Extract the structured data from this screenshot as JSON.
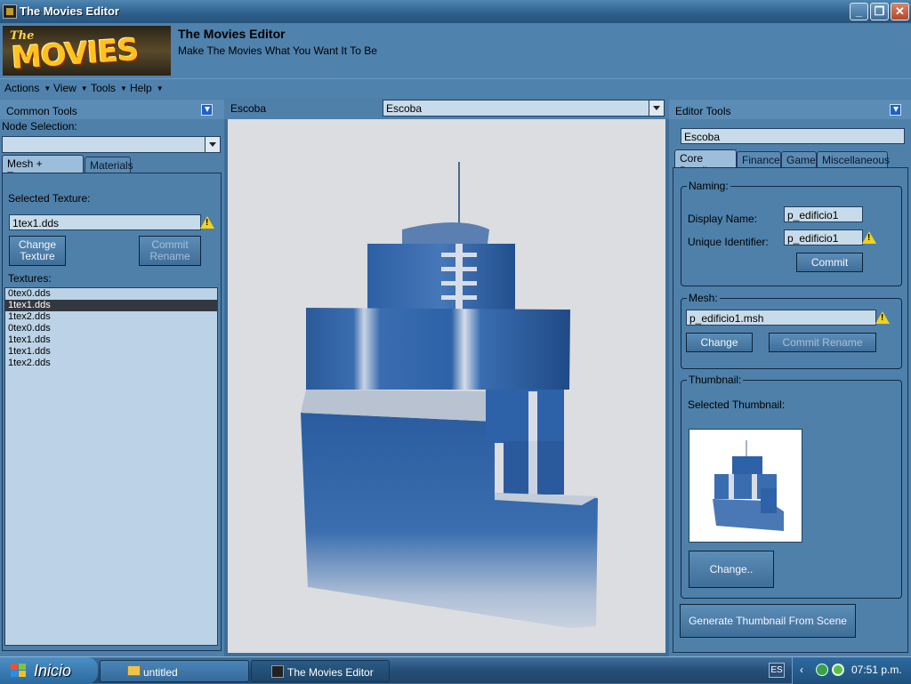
{
  "window": {
    "title": "The Movies Editor"
  },
  "header": {
    "logo_text_small": "The",
    "logo_text_big": "MOVIES",
    "title": "The Movies Editor",
    "subtitle": "Make The Movies What You Want It To Be"
  },
  "menu": [
    {
      "label": "Actions"
    },
    {
      "label": "View"
    },
    {
      "label": "Tools"
    },
    {
      "label": "Help"
    }
  ],
  "common_tools": {
    "header": "Common Tools",
    "node_selection_label": "Node Selection:",
    "node_selection_value": "",
    "tabs": [
      {
        "label": "Mesh + Textures"
      },
      {
        "label": "Materials"
      }
    ],
    "selected_texture_label": "Selected Texture:",
    "selected_texture_value": "1tex1.dds",
    "change_texture_label": "Change Texture",
    "commit_rename_label": "Commit Rename",
    "textures_label": "Textures:",
    "textures": [
      "0tex0.dds",
      "1tex1.dds",
      "1tex2.dds",
      "0tex0.dds",
      "1tex1.dds",
      "1tex1.dds",
      "1tex2.dds"
    ],
    "selected_index": 1
  },
  "viewport": {
    "object_label": "Escoba",
    "object_combo_value": "Escoba"
  },
  "editor_tools": {
    "header": "Editor Tools",
    "object_name": "Escoba",
    "tabs": [
      {
        "label": "Core Details"
      },
      {
        "label": "Finance"
      },
      {
        "label": "Game"
      },
      {
        "label": "Miscellaneous"
      }
    ],
    "naming": {
      "legend": "Naming:",
      "display_name_label": "Display Name:",
      "display_name_value": "p_edificio1",
      "unique_id_label": "Unique Identifier:",
      "unique_id_value": "p_edificio1",
      "commit_label": "Commit"
    },
    "mesh": {
      "legend": "Mesh:",
      "value": "p_edificio1.msh",
      "change_label": "Change",
      "commit_rename_label": "Commit Rename"
    },
    "thumbnail": {
      "legend": "Thumbnail:",
      "selected_label": "Selected Thumbnail:",
      "change_label": "Change.."
    },
    "generate_label": "Generate Thumbnail  From Scene"
  },
  "taskbar": {
    "start_label": "Inicio",
    "tasks": [
      {
        "label": "untitled"
      },
      {
        "label": "The Movies Editor"
      }
    ],
    "language": "ES",
    "clock": "07:51 p.m."
  },
  "colors": {
    "panel": "#4e80aa",
    "accent": "#1f61c6",
    "building": "#2c5f9e"
  }
}
